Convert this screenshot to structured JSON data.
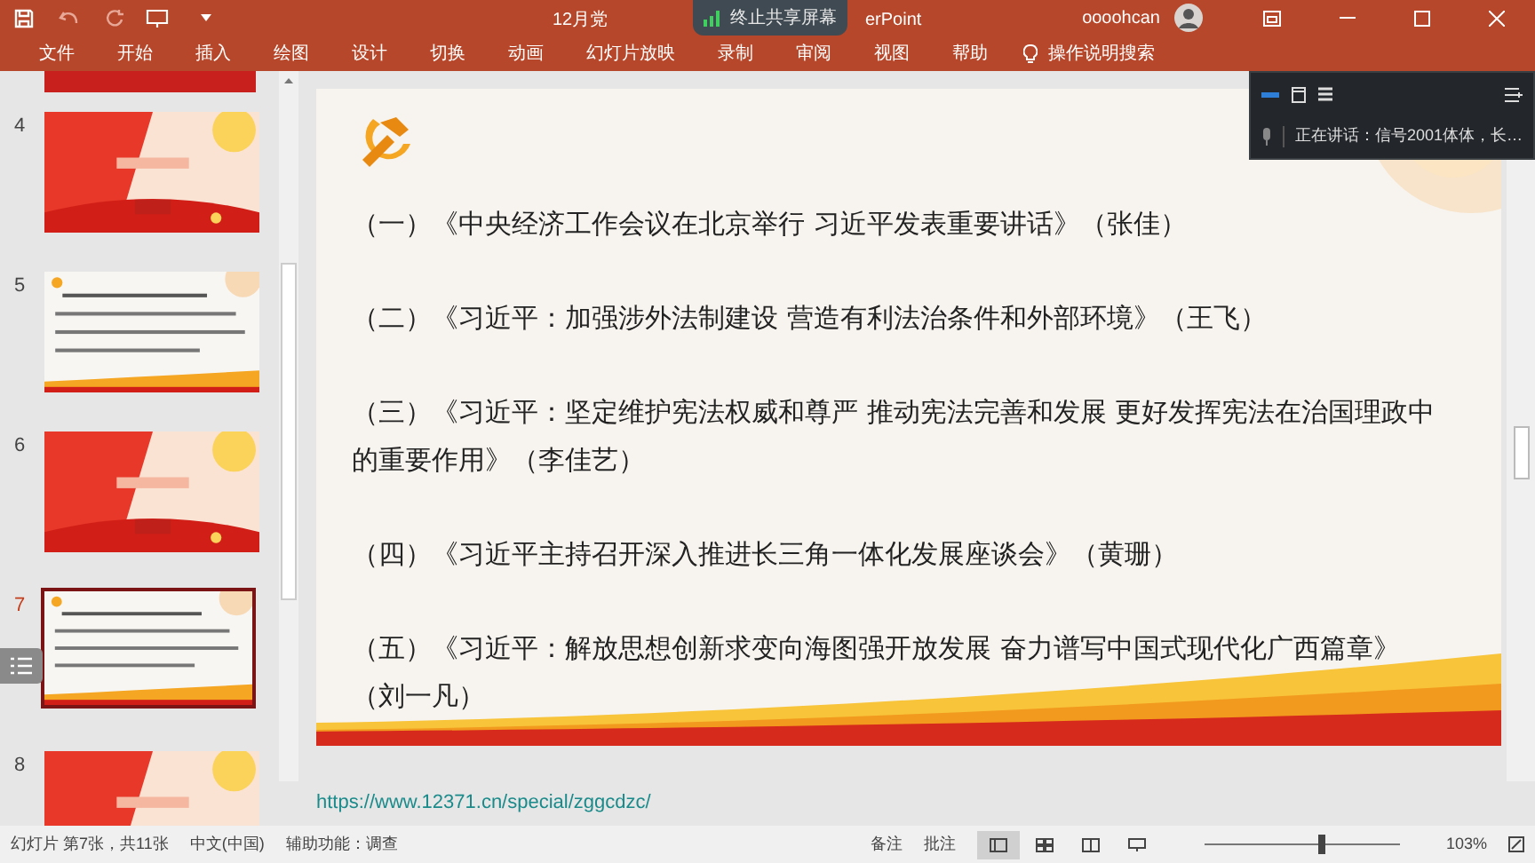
{
  "title_bar": {
    "title_start": "12月党",
    "title_end": "erPoint",
    "share_pill": "终止共享屏幕",
    "user": "oooohcan"
  },
  "ribbon_tabs": [
    "文件",
    "开始",
    "插入",
    "绘图",
    "设计",
    "切换",
    "动画",
    "幻灯片放映",
    "录制",
    "审阅",
    "视图",
    "帮助"
  ],
  "ribbon_search": "操作说明搜索",
  "thumbnails": [
    {
      "number": "4",
      "selected": false
    },
    {
      "number": "5",
      "selected": false
    },
    {
      "number": "6",
      "selected": false
    },
    {
      "number": "7",
      "selected": true
    },
    {
      "number": "8",
      "selected": false
    }
  ],
  "slide": {
    "items": [
      "（一）《中央经济工作会议在北京举行 习近平发表重要讲话》（张佳）",
      "（二）《习近平：加强涉外法制建设 营造有利法治条件和外部环境》（王飞）",
      "（三）《习近平：坚定维护宪法权威和尊严 推动宪法完善和发展 更好发挥宪法在治国理政中的重要作用》（李佳艺）",
      "（四）《习近平主持召开深入推进长三角一体化发展座谈会》（黄珊）",
      "（五）《习近平：解放思想创新求变向海图强开放发展 奋力谱写中国式现代化广西篇章》（刘一凡）"
    ]
  },
  "meeting_panel": {
    "speaking": "正在讲话：信号2001体体，长…"
  },
  "notes": {
    "link": "https://www.12371.cn/special/zggcdzc/"
  },
  "status_bar": {
    "slide_count": "幻灯片 第7张，共11张",
    "language": "中文(中国)",
    "accessibility": "辅助功能：调查",
    "notes_button": "备注",
    "comments_button": "批注",
    "zoom": "103%"
  },
  "zoom_slider": {
    "level": 0.6
  }
}
